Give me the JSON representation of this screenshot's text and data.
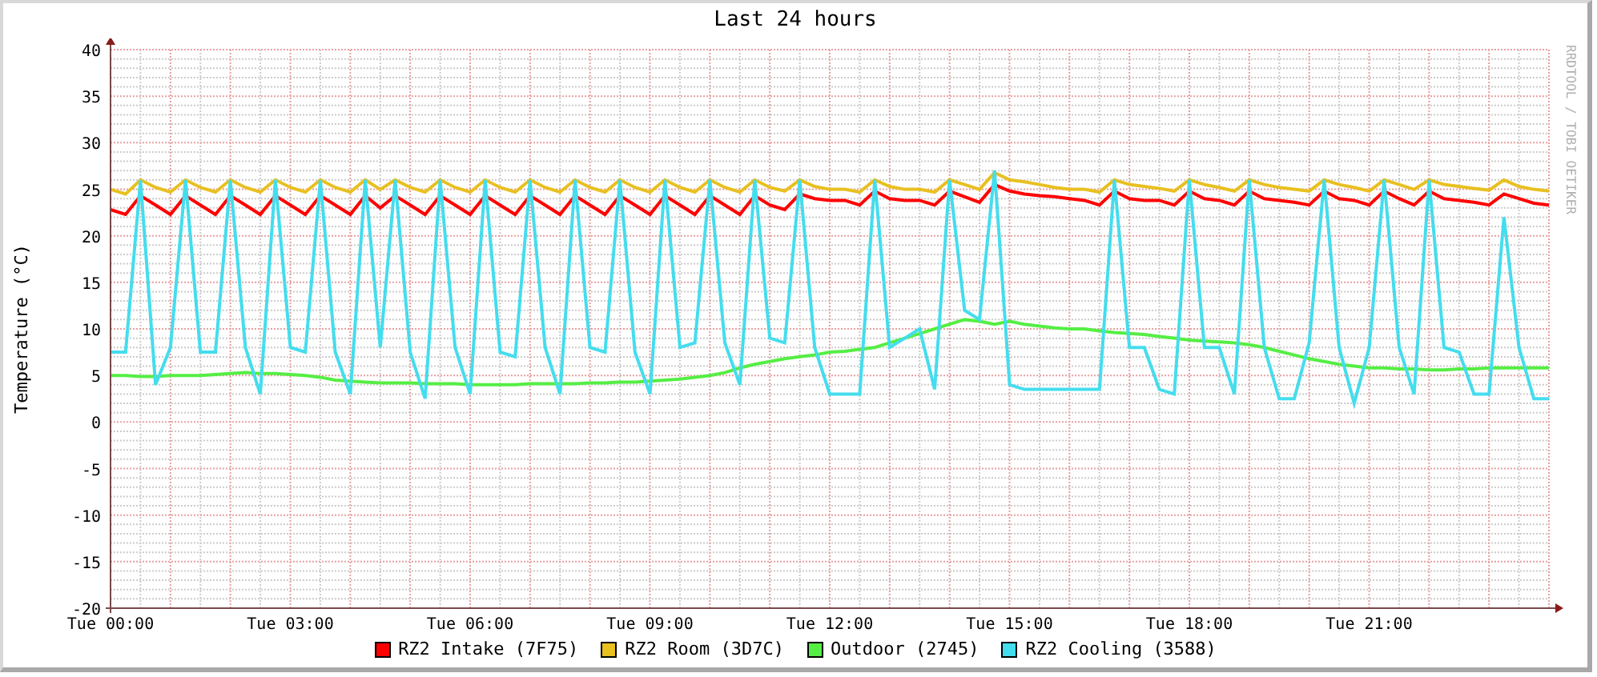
{
  "title": "Last 24 hours",
  "credit": "RRDTOOL / TOBI OETIKER",
  "chart_data": {
    "type": "line",
    "ylabel": "Temperature (°C)",
    "categories": [
      "Tue 00:00",
      null,
      null,
      null,
      null,
      null,
      null,
      null,
      null,
      null,
      null,
      null,
      "Tue 03:00",
      null,
      null,
      null,
      null,
      null,
      null,
      null,
      null,
      null,
      null,
      null,
      "Tue 06:00",
      null,
      null,
      null,
      null,
      null,
      null,
      null,
      null,
      null,
      null,
      null,
      "Tue 09:00",
      null,
      null,
      null,
      null,
      null,
      null,
      null,
      null,
      null,
      null,
      null,
      "Tue 12:00",
      null,
      null,
      null,
      null,
      null,
      null,
      null,
      null,
      null,
      null,
      null,
      "Tue 15:00",
      null,
      null,
      null,
      null,
      null,
      null,
      null,
      null,
      null,
      null,
      null,
      "Tue 18:00",
      null,
      null,
      null,
      null,
      null,
      null,
      null,
      null,
      null,
      null,
      null,
      "Tue 21:00",
      null,
      null,
      null,
      null,
      null,
      null,
      null,
      null,
      null,
      null,
      null,
      null
    ],
    "series": [
      {
        "name": "RZ2 Intake (7F75)",
        "color": "#ff0000",
        "values": [
          22.8,
          22.3,
          24.3,
          23.3,
          22.3,
          24.3,
          23.3,
          22.3,
          24.3,
          23.3,
          22.3,
          24.3,
          23.3,
          22.3,
          24.3,
          23.3,
          22.3,
          24.3,
          23,
          24.3,
          23.3,
          22.3,
          24.3,
          23.3,
          22.3,
          24.3,
          23.3,
          22.3,
          24.3,
          23.3,
          22.3,
          24.3,
          23.3,
          22.3,
          24.3,
          23.3,
          22.3,
          24.3,
          23.3,
          22.3,
          24.3,
          23.3,
          22.3,
          24.3,
          23.3,
          22.8,
          24.5,
          24,
          23.8,
          23.8,
          23.3,
          24.8,
          24,
          23.8,
          23.8,
          23.3,
          24.8,
          24.2,
          23.6,
          25.5,
          24.8,
          24.5,
          24.3,
          24.2,
          24,
          23.8,
          23.3,
          24.8,
          24,
          23.8,
          23.8,
          23.3,
          24.8,
          24,
          23.8,
          23.3,
          24.8,
          24,
          23.8,
          23.6,
          23.3,
          24.8,
          24,
          23.8,
          23.3,
          24.8,
          24,
          23.3,
          24.8,
          24,
          23.8,
          23.6,
          23.3,
          24.5,
          24,
          23.5,
          23.3
        ]
      },
      {
        "name": "RZ2 Room (3D7C)",
        "color": "#e8c020",
        "values": [
          25,
          24.5,
          26,
          25.2,
          24.7,
          26,
          25.2,
          24.7,
          26,
          25.2,
          24.7,
          26,
          25.2,
          24.7,
          26,
          25.2,
          24.7,
          26,
          25,
          26,
          25.2,
          24.7,
          26,
          25.2,
          24.7,
          26,
          25.2,
          24.7,
          26,
          25.2,
          24.7,
          26,
          25.2,
          24.7,
          26,
          25.2,
          24.7,
          26,
          25.2,
          24.7,
          26,
          25.2,
          24.7,
          26,
          25.2,
          24.8,
          26,
          25.3,
          25,
          25,
          24.7,
          26,
          25.3,
          25,
          25,
          24.7,
          26,
          25.5,
          25,
          26.8,
          26,
          25.8,
          25.5,
          25.2,
          25,
          25,
          24.7,
          26,
          25.5,
          25.3,
          25.1,
          24.8,
          26,
          25.5,
          25.2,
          24.8,
          26,
          25.5,
          25.2,
          25,
          24.8,
          26,
          25.5,
          25.2,
          24.8,
          26,
          25.5,
          25,
          26,
          25.5,
          25.3,
          25.1,
          24.9,
          26,
          25.3,
          25,
          24.8
        ]
      },
      {
        "name": "Outdoor (2745)",
        "color": "#55ee44",
        "values": [
          5,
          5,
          4.9,
          4.9,
          5,
          5,
          5,
          5.1,
          5.2,
          5.3,
          5.2,
          5.2,
          5.1,
          5,
          4.8,
          4.5,
          4.4,
          4.3,
          4.2,
          4.2,
          4.2,
          4.1,
          4.1,
          4.1,
          4,
          4,
          4,
          4,
          4.1,
          4.1,
          4.1,
          4.1,
          4.2,
          4.2,
          4.3,
          4.3,
          4.4,
          4.5,
          4.6,
          4.8,
          5,
          5.3,
          5.8,
          6.2,
          6.5,
          6.8,
          7,
          7.2,
          7.5,
          7.6,
          7.8,
          8,
          8.5,
          9,
          9.5,
          10,
          10.5,
          11,
          10.8,
          10.5,
          10.8,
          10.5,
          10.3,
          10.1,
          10,
          10,
          9.8,
          9.6,
          9.5,
          9.4,
          9.2,
          9,
          8.8,
          8.7,
          8.6,
          8.5,
          8.3,
          8,
          7.6,
          7.2,
          6.8,
          6.5,
          6.2,
          6,
          5.8,
          5.8,
          5.7,
          5.7,
          5.6,
          5.6,
          5.7,
          5.7,
          5.8,
          5.8,
          5.8,
          5.8,
          5.8
        ]
      },
      {
        "name": "RZ2 Cooling (3588)",
        "color": "#44ddee",
        "values": [
          7.5,
          7.5,
          26,
          4,
          8,
          26,
          7.5,
          7.5,
          26,
          8,
          3,
          26,
          8,
          7.5,
          26,
          7.5,
          3,
          26,
          8,
          26,
          7.5,
          2.5,
          26,
          8,
          3,
          26,
          7.5,
          7,
          26,
          8,
          3,
          26,
          8,
          7.5,
          26,
          7.5,
          3,
          26,
          8,
          8.5,
          26,
          8.5,
          4,
          26,
          9,
          8.5,
          26,
          8,
          3,
          3,
          3,
          26,
          8,
          9,
          10,
          3.5,
          26,
          12,
          11,
          27,
          4,
          3.5,
          3.5,
          3.5,
          3.5,
          3.5,
          3.5,
          26,
          8,
          8,
          3.5,
          3,
          26,
          8,
          8,
          3,
          26,
          8,
          2.5,
          2.5,
          8.5,
          26,
          8,
          2,
          8,
          26,
          8,
          3,
          26,
          8,
          7.5,
          3,
          3,
          22,
          8,
          2.5,
          2.5
        ]
      }
    ],
    "grid": true,
    "ylim": [
      -20,
      40
    ],
    "yticks": [
      -20,
      -15,
      -10,
      -5,
      0,
      5,
      10,
      15,
      20,
      25,
      30,
      35,
      40
    ]
  }
}
